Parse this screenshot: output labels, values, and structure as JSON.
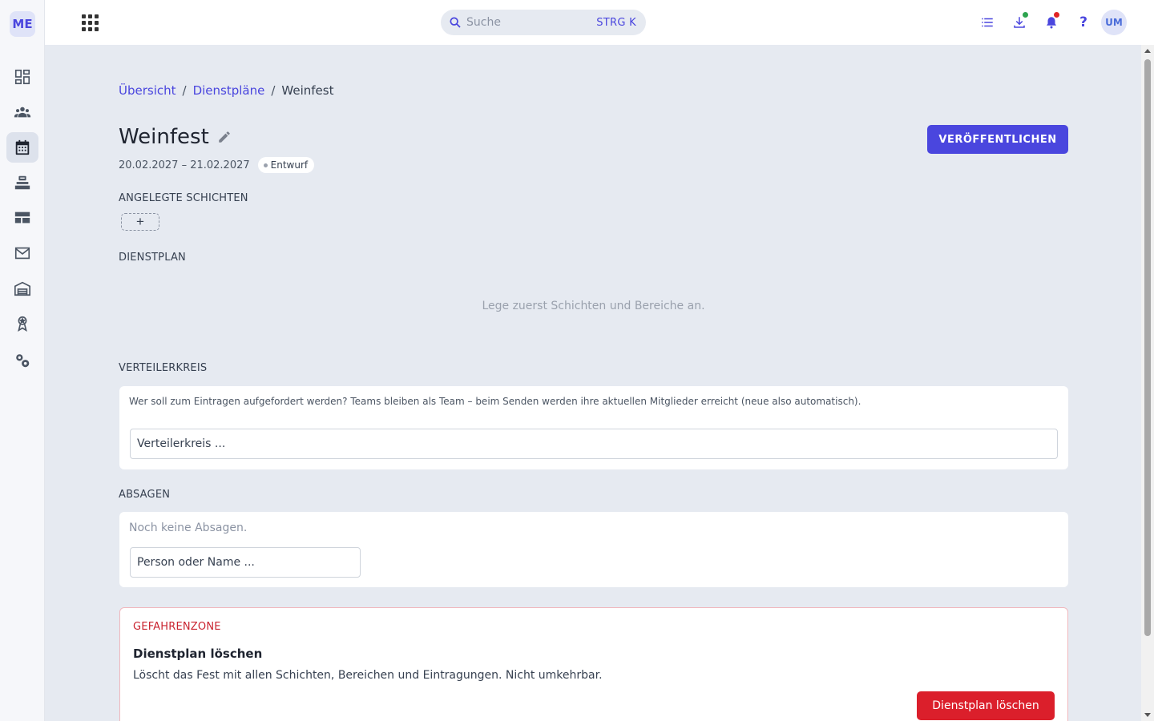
{
  "rail": {
    "logo": "ME",
    "items": [
      {
        "icon": "dashboard-icon",
        "active": false
      },
      {
        "icon": "people-icon",
        "active": false
      },
      {
        "icon": "calendar-icon",
        "active": true
      },
      {
        "icon": "inbox-stack-icon",
        "active": false
      },
      {
        "icon": "table-icon",
        "active": false
      },
      {
        "icon": "mail-icon",
        "active": false
      },
      {
        "icon": "warehouse-icon",
        "active": false
      },
      {
        "icon": "award-icon",
        "active": false
      },
      {
        "icon": "settings-icon",
        "active": false
      }
    ]
  },
  "topbar": {
    "search_placeholder": "Suche",
    "search_shortcut": "STRG K",
    "avatar": "UM"
  },
  "breadcrumb": {
    "items": [
      "Übersicht",
      "Dienstpläne"
    ],
    "current": "Weinfest",
    "separator": "/"
  },
  "page": {
    "title": "Weinfest",
    "dates": "20.02.2027 – 21.02.2027",
    "status": "Entwurf",
    "publish_label": "VERÖFFENTLICHEN"
  },
  "shifts": {
    "title": "ANGELEGTE SCHICHTEN",
    "add_label": "+"
  },
  "roster": {
    "title": "DIENSTPLAN",
    "empty_hint": "Lege zuerst Schichten und Bereiche an."
  },
  "distribution": {
    "title": "VERTEILERKREIS",
    "help": "Wer soll zum Eintragen aufgefordert werden? Teams bleiben als Team – beim Senden werden ihre aktuellen Mitglieder erreicht (neue also automatisch).",
    "input_placeholder": "Verteilerkreis ..."
  },
  "cancellations": {
    "title": "ABSAGEN",
    "empty": "Noch keine Absagen.",
    "input_placeholder": "Person oder Name ..."
  },
  "danger": {
    "label": "GEFAHRENZONE",
    "heading": "Dienstplan löschen",
    "description": "Löscht das Fest mit allen Schichten, Bereichen und Eintragungen. Nicht umkehrbar.",
    "button": "Dienstplan löschen"
  },
  "colors": {
    "accent": "#4a46de",
    "danger": "#db1f2b",
    "background": "#e6eaf1"
  }
}
